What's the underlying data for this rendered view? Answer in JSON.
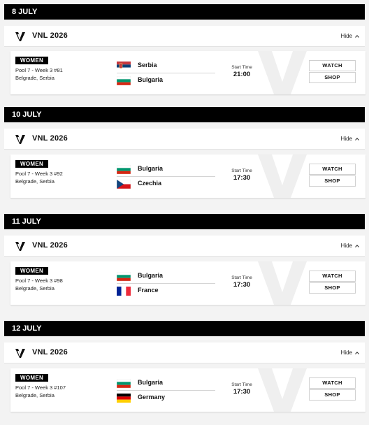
{
  "days": [
    {
      "date": "8 JULY",
      "competition": "VNL 2026",
      "toggle_label": "Hide",
      "match": {
        "gender": "WOMEN",
        "pool_info": "Pool 7 - Week 3 #81",
        "location": "Belgrade, Serbia",
        "home": {
          "name": "Serbia",
          "flag": "serbia-flag"
        },
        "away": {
          "name": "Bulgaria",
          "flag": "bulgaria-flag"
        },
        "start_label": "Start Time",
        "start_time": "21:00",
        "watch_label": "WATCH",
        "shop_label": "SHOP"
      }
    },
    {
      "date": "10 JULY",
      "competition": "VNL 2026",
      "toggle_label": "Hide",
      "match": {
        "gender": "WOMEN",
        "pool_info": "Pool 7 - Week 3 #92",
        "location": "Belgrade, Serbia",
        "home": {
          "name": "Bulgaria",
          "flag": "bulgaria-flag"
        },
        "away": {
          "name": "Czechia",
          "flag": "czechia-flag"
        },
        "start_label": "Start Time",
        "start_time": "17:30",
        "watch_label": "WATCH",
        "shop_label": "SHOP"
      }
    },
    {
      "date": "11 JULY",
      "competition": "VNL 2026",
      "toggle_label": "Hide",
      "match": {
        "gender": "WOMEN",
        "pool_info": "Pool 7 - Week 3 #98",
        "location": "Belgrade, Serbia",
        "home": {
          "name": "Bulgaria",
          "flag": "bulgaria-flag"
        },
        "away": {
          "name": "France",
          "flag": "france-flag"
        },
        "start_label": "Start Time",
        "start_time": "17:30",
        "watch_label": "WATCH",
        "shop_label": "SHOP"
      }
    },
    {
      "date": "12 JULY",
      "competition": "VNL 2026",
      "toggle_label": "Hide",
      "match": {
        "gender": "WOMEN",
        "pool_info": "Pool 7 - Week 3 #107",
        "location": "Belgrade, Serbia",
        "home": {
          "name": "Bulgaria",
          "flag": "bulgaria-flag"
        },
        "away": {
          "name": "Germany",
          "flag": "germany-flag"
        },
        "start_label": "Start Time",
        "start_time": "17:30",
        "watch_label": "WATCH",
        "shop_label": "SHOP"
      }
    }
  ]
}
